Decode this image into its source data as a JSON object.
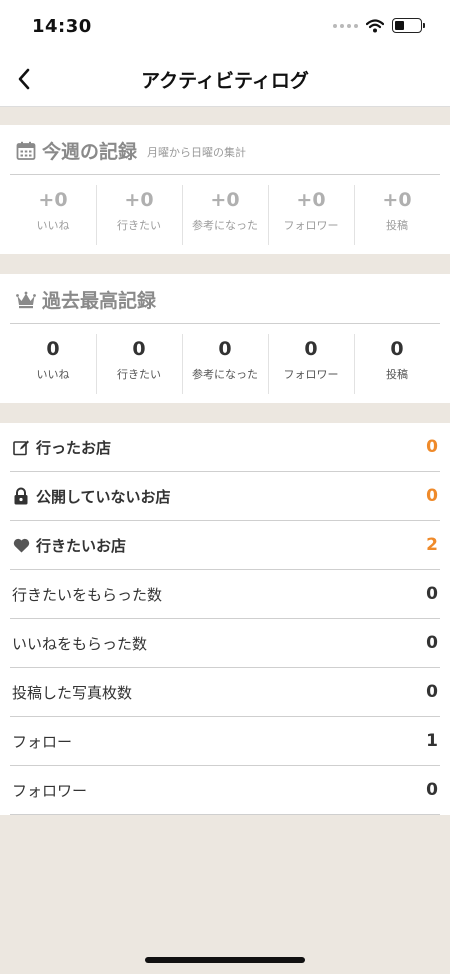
{
  "status_bar": {
    "time": "14:30"
  },
  "nav": {
    "title": "アクティビティログ",
    "back_icon": "chevron-left-icon"
  },
  "weekly": {
    "title": "今週の記録",
    "subtitle": "月曜から日曜の集計",
    "stats": [
      {
        "value": "+0",
        "label": "いいね"
      },
      {
        "value": "+0",
        "label": "行きたい"
      },
      {
        "value": "+0",
        "label": "参考になった"
      },
      {
        "value": "+0",
        "label": "フォロワー"
      },
      {
        "value": "+0",
        "label": "投稿"
      }
    ]
  },
  "best": {
    "title": "過去最高記録",
    "stats": [
      {
        "value": "0",
        "label": "いいね"
      },
      {
        "value": "0",
        "label": "行きたい"
      },
      {
        "value": "0",
        "label": "参考になった"
      },
      {
        "value": "0",
        "label": "フォロワー"
      },
      {
        "value": "0",
        "label": "投稿"
      }
    ]
  },
  "list": {
    "rows": [
      {
        "label": "行ったお店",
        "value": "0",
        "icon": "edit-icon"
      },
      {
        "label": "公開していないお店",
        "value": "0",
        "icon": "lock-icon"
      },
      {
        "label": "行きたいお店",
        "value": "2",
        "icon": "heart-icon"
      },
      {
        "label": "行きたいをもらった数",
        "value": "0"
      },
      {
        "label": "いいねをもらった数",
        "value": "0"
      },
      {
        "label": "投稿した写真枚数",
        "value": "0"
      },
      {
        "label": "フォロー",
        "value": "1"
      },
      {
        "label": "フォロワー",
        "value": "0"
      }
    ]
  },
  "colors": {
    "accent": "#ef8a2a",
    "background": "#ece7e0"
  }
}
